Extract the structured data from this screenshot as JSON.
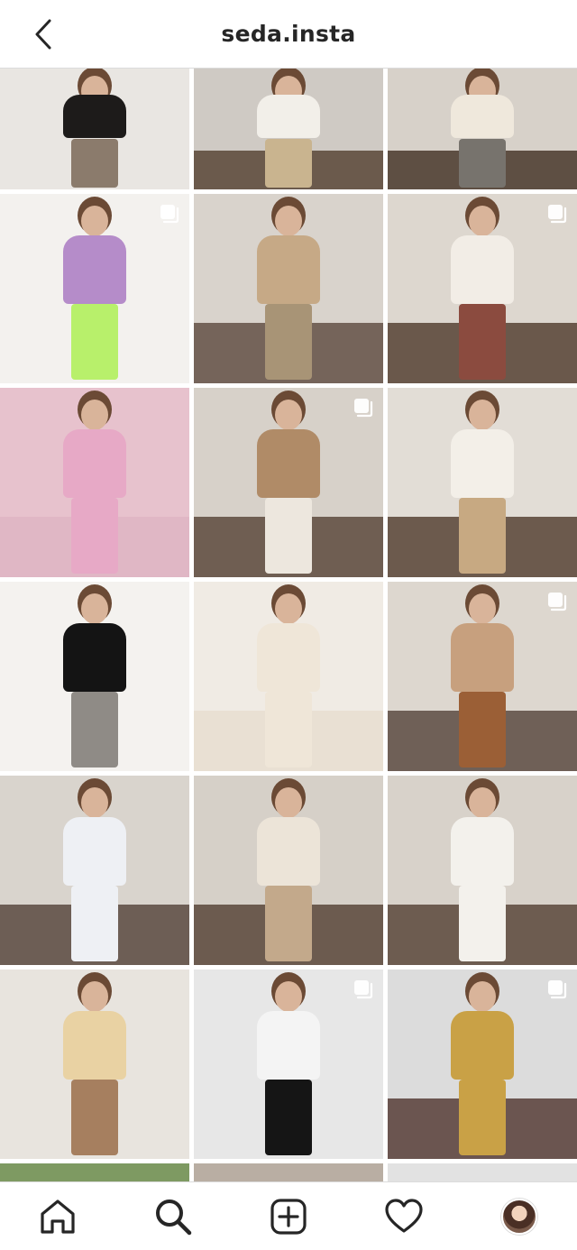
{
  "header": {
    "title": "seda.insta",
    "back_icon": "chevron-left-icon"
  },
  "grid": {
    "posts": [
      {
        "bg": "#e9e6e2",
        "top": "#1d1b1a",
        "bottom": "#8b7b6c",
        "floor": "#e9e6e2",
        "multi": false
      },
      {
        "bg": "#cfcac4",
        "top": "#f2efe9",
        "bottom": "#c9b48f",
        "floor": "#6b5a4c",
        "multi": false
      },
      {
        "bg": "#d7d1c9",
        "top": "#efe8dc",
        "bottom": "#77736d",
        "floor": "#5e4f43",
        "multi": false
      },
      {
        "bg": "#f3f1ee",
        "top": "#b58cc9",
        "bottom": "#b8f06b",
        "floor": "#f3f1ee",
        "multi": true
      },
      {
        "bg": "#d9d3cc",
        "top": "#c6a986",
        "bottom": "#a89476",
        "floor": "#75645a",
        "multi": false
      },
      {
        "bg": "#ddd7cf",
        "top": "#f2ede6",
        "bottom": "#8b4b3f",
        "floor": "#6a584b",
        "multi": true
      },
      {
        "bg": "#e7c2cd",
        "top": "#e7a9c6",
        "bottom": "#e7a9c6",
        "floor": "#e0b7c5",
        "multi": false
      },
      {
        "bg": "#d7d1c9",
        "top": "#b08b67",
        "bottom": "#ede7de",
        "floor": "#6f5e52",
        "multi": true
      },
      {
        "bg": "#e2ddd6",
        "top": "#f3efe8",
        "bottom": "#c7a982",
        "floor": "#6c5a4d",
        "multi": false
      },
      {
        "bg": "#f4f2ef",
        "top": "#141414",
        "bottom": "#8f8b86",
        "floor": "#f4f2ef",
        "multi": false
      },
      {
        "bg": "#f0ebe4",
        "top": "#efe6d8",
        "bottom": "#efe6d8",
        "floor": "#e9e0d3",
        "multi": false
      },
      {
        "bg": "#ddd7cf",
        "top": "#c7a07e",
        "bottom": "#9b5f36",
        "floor": "#6f6057",
        "multi": true
      },
      {
        "bg": "#d9d4cd",
        "top": "#eef0f4",
        "bottom": "#eef0f4",
        "floor": "#6d5e55",
        "multi": false
      },
      {
        "bg": "#d6d0c8",
        "top": "#ece4d8",
        "bottom": "#c3a98b",
        "floor": "#6c5b4f",
        "multi": false
      },
      {
        "bg": "#d8d2ca",
        "top": "#f3f1ec",
        "bottom": "#f3f1ec",
        "floor": "#6d5c50",
        "multi": false
      },
      {
        "bg": "#e8e4de",
        "top": "#e9d2a3",
        "bottom": "#a67f5f",
        "floor": "#e8e4de",
        "multi": false
      },
      {
        "bg": "#e7e7e7",
        "top": "#f4f4f4",
        "bottom": "#151515",
        "floor": "#e7e7e7",
        "multi": true
      },
      {
        "bg": "#dcdcdc",
        "top": "#c9a146",
        "bottom": "#c9a146",
        "floor": "#6b5550",
        "multi": true
      },
      {
        "bg": "#7e9a62",
        "top": "#7e9a62",
        "bottom": "#7e9a62",
        "floor": "#7e9a62",
        "multi": true
      },
      {
        "bg": "#b9aea3",
        "top": "#b9aea3",
        "bottom": "#b9aea3",
        "floor": "#b9aea3",
        "multi": false
      },
      {
        "bg": "#e2e2e2",
        "top": "#e2e2e2",
        "bottom": "#e2e2e2",
        "floor": "#e2e2e2",
        "multi": false
      }
    ]
  },
  "tabbar": {
    "items": [
      {
        "name": "tab-home",
        "icon": "home-icon"
      },
      {
        "name": "tab-search",
        "icon": "search-icon"
      },
      {
        "name": "tab-new-post",
        "icon": "add-post-icon"
      },
      {
        "name": "tab-activity",
        "icon": "heart-icon"
      },
      {
        "name": "tab-profile",
        "icon": "profile-avatar"
      }
    ]
  }
}
